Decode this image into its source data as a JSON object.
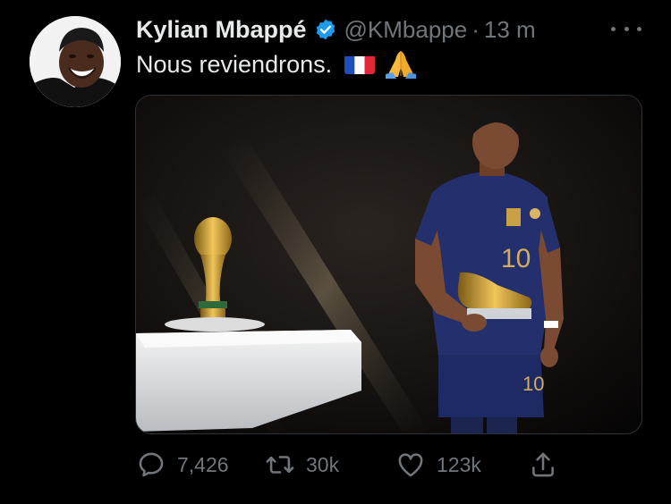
{
  "tweet": {
    "author_name": "Kylian Mbappé",
    "handle": "@KMbappe",
    "separator": "·",
    "time": "13 m",
    "text": "Nous reviendrons.",
    "emojis": [
      "france-flag",
      "folded-hands"
    ],
    "verified_color": "#1d9bf0",
    "media": {
      "jersey_number": "10",
      "description_icons": [
        "world-cup-trophy",
        "golden-boot"
      ]
    }
  },
  "actions": {
    "replies": "7,426",
    "retweets": "30k",
    "likes": "123k"
  },
  "colors": {
    "background": "#000000",
    "text_primary": "#e7e9ea",
    "text_secondary": "#71767b"
  }
}
